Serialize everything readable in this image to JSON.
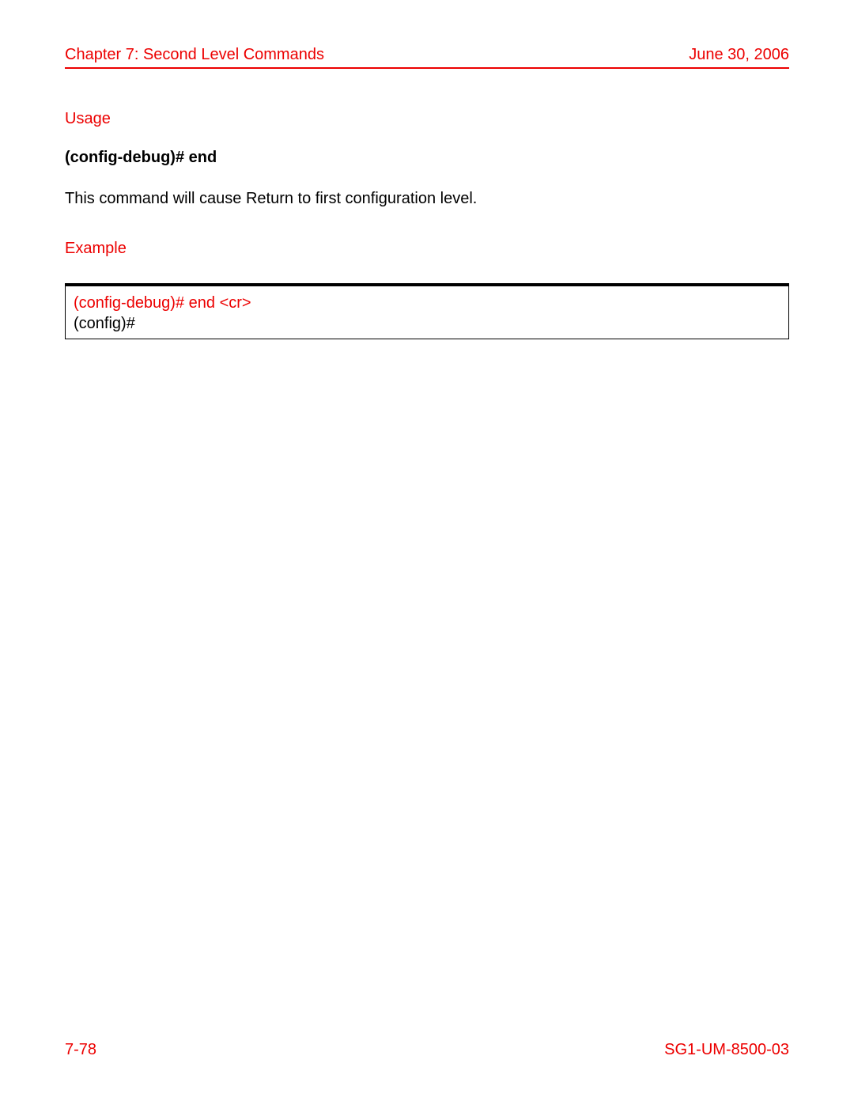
{
  "header": {
    "chapter": "Chapter 7: Second Level Commands",
    "date": "June 30, 2006"
  },
  "sections": {
    "usage_heading": "Usage",
    "usage_command": "(config-debug)# end",
    "usage_description": "This command will cause Return to first configuration level.",
    "example_heading": "Example",
    "example_input": "(config-debug)# end  <cr>",
    "example_output": "(config)#"
  },
  "footer": {
    "page_number": "7-78",
    "doc_id": "SG1-UM-8500-03"
  }
}
